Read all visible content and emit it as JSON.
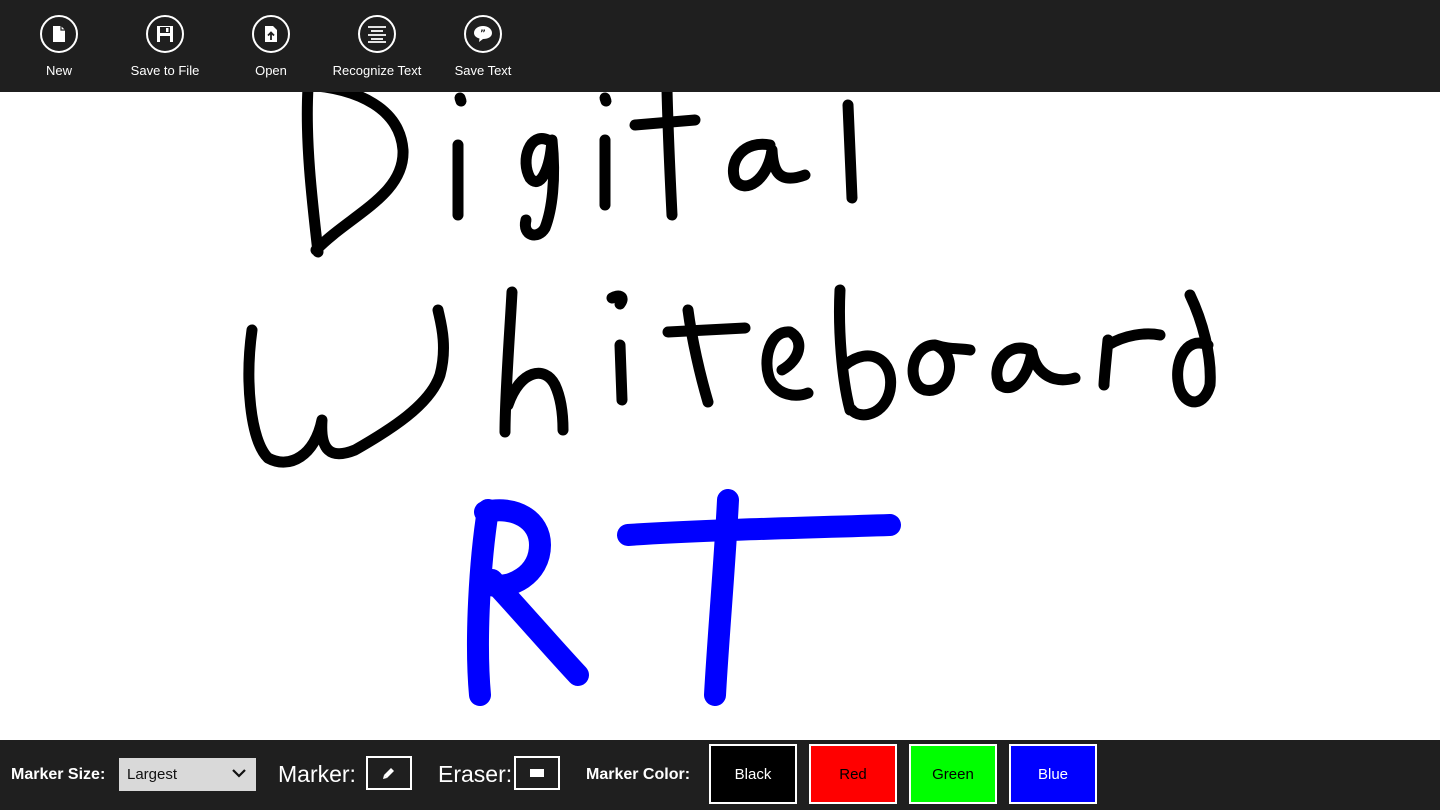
{
  "toolbar": {
    "buttons": [
      {
        "label": "New",
        "icon": "new-document-icon"
      },
      {
        "label": "Save to File",
        "icon": "save-icon"
      },
      {
        "label": "Open",
        "icon": "open-file-icon"
      },
      {
        "label": "Recognize Text",
        "icon": "align-text-icon"
      },
      {
        "label": "Save Text",
        "icon": "speech-bubble-icon"
      }
    ]
  },
  "canvas": {
    "ink_black": "#000000",
    "ink_blue": "#0000ff",
    "handwriting_lines": [
      "Digital",
      "Whiteboard",
      "RT"
    ]
  },
  "bottom": {
    "marker_size_label": "Marker Size:",
    "marker_size_value": "Largest",
    "marker_label": "Marker:",
    "eraser_label": "Eraser:",
    "marker_color_label": "Marker Color:",
    "colors": [
      {
        "label": "Black",
        "bg": "#000000",
        "fg": "#ffffff"
      },
      {
        "label": "Red",
        "bg": "#ff0000",
        "fg": "#000000"
      },
      {
        "label": "Green",
        "bg": "#00ff00",
        "fg": "#000000"
      },
      {
        "label": "Blue",
        "bg": "#0000ff",
        "fg": "#ffffff"
      }
    ]
  },
  "theme": {
    "bar_bg": "#1f1f1f",
    "canvas_bg": "#ffffff"
  }
}
